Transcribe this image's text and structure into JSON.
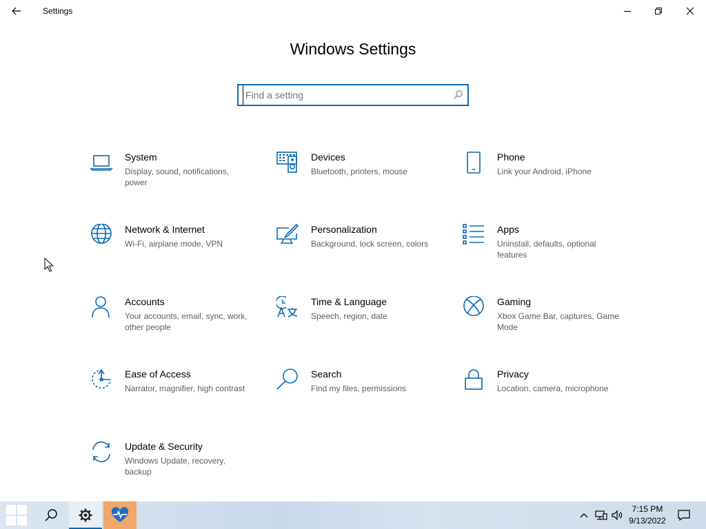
{
  "titlebar": {
    "app_title": "Settings",
    "back_icon": "back-arrow-icon",
    "minimize_icon": "minimize-icon",
    "maximize_icon": "restore-icon",
    "close_icon": "close-icon"
  },
  "header": {
    "title": "Windows Settings"
  },
  "search": {
    "value": "",
    "placeholder": "Find a setting",
    "icon": "search-icon"
  },
  "accent_color": "#0a68b4",
  "categories": [
    {
      "name": "System",
      "description": "Display, sound, notifications, power",
      "icon": "laptop-icon"
    },
    {
      "name": "Devices",
      "description": "Bluetooth, printers, mouse",
      "icon": "keyboard-speaker-icon"
    },
    {
      "name": "Phone",
      "description": "Link your Android, iPhone",
      "icon": "phone-icon"
    },
    {
      "name": "Network & Internet",
      "description": "Wi-Fi, airplane mode, VPN",
      "icon": "globe-icon"
    },
    {
      "name": "Personalization",
      "description": "Background, lock screen, colors",
      "icon": "monitor-brush-icon"
    },
    {
      "name": "Apps",
      "description": "Uninstall, defaults, optional features",
      "icon": "apps-list-icon"
    },
    {
      "name": "Accounts",
      "description": "Your accounts, email, sync, work, other people",
      "icon": "person-icon"
    },
    {
      "name": "Time & Language",
      "description": "Speech, region, date",
      "icon": "time-language-icon"
    },
    {
      "name": "Gaming",
      "description": "Xbox Game Bar, captures, Game Mode",
      "icon": "xbox-icon"
    },
    {
      "name": "Ease of Access",
      "description": "Narrator, magnifier, high contrast",
      "icon": "ease-of-access-icon"
    },
    {
      "name": "Search",
      "description": "Find my files, permissions",
      "icon": "magnifier-icon"
    },
    {
      "name": "Privacy",
      "description": "Location, camera, microphone",
      "icon": "lock-icon"
    },
    {
      "name": "Update & Security",
      "description": "Windows Update, recovery, backup",
      "icon": "sync-arrows-icon"
    }
  ],
  "taskbar": {
    "start_icon": "windows-logo-icon",
    "search_icon": "search-icon",
    "pinned": [
      {
        "app": "settings",
        "icon": "gear-icon"
      },
      {
        "app": "health",
        "icon": "heart-pulse-icon"
      }
    ],
    "tray": {
      "chevron_icon": "chevron-up-icon",
      "network_icon": "network-icon",
      "volume_icon": "speaker-icon",
      "notification_icon": "notification-icon"
    },
    "clock": {
      "time": "7:15 PM",
      "date": "9/13/2022"
    }
  }
}
